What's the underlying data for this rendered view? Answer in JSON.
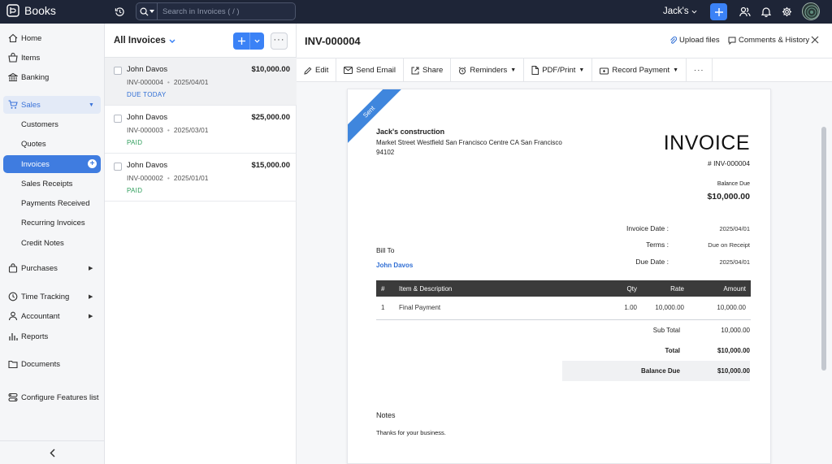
{
  "app": {
    "name": "Books"
  },
  "search": {
    "placeholder": "Search in Invoices ( / )"
  },
  "org": {
    "name": "Jack's"
  },
  "sidebar": {
    "items": [
      {
        "label": "Home",
        "icon": "home-icon"
      },
      {
        "label": "Items",
        "icon": "basket-icon"
      },
      {
        "label": "Banking",
        "icon": "bank-icon"
      },
      {
        "label": "Sales",
        "icon": "cart-icon"
      },
      {
        "label": "Customers"
      },
      {
        "label": "Quotes"
      },
      {
        "label": "Invoices"
      },
      {
        "label": "Sales Receipts"
      },
      {
        "label": "Payments Received"
      },
      {
        "label": "Recurring Invoices"
      },
      {
        "label": "Credit Notes"
      },
      {
        "label": "Purchases",
        "icon": "bag-icon"
      },
      {
        "label": "Time Tracking",
        "icon": "clock-icon"
      },
      {
        "label": "Accountant",
        "icon": "person-icon"
      },
      {
        "label": "Reports",
        "icon": "bar-chart-icon"
      },
      {
        "label": "Documents",
        "icon": "folder-icon"
      },
      {
        "label": "Configure Features list",
        "icon": "sliders-icon"
      }
    ],
    "collapse": "‹"
  },
  "list": {
    "title": "All Invoices",
    "more": "···",
    "rows": [
      {
        "customer": "John Davos",
        "amount": "$10,000.00",
        "number": "INV-000004",
        "date": "2025/04/01",
        "status": "DUE TODAY",
        "status_color": "#2f6ed4"
      },
      {
        "customer": "John Davos",
        "amount": "$25,000.00",
        "number": "INV-000003",
        "date": "2025/03/01",
        "status": "PAID",
        "status_color": "#2e9e5b"
      },
      {
        "customer": "John Davos",
        "amount": "$15,000.00",
        "number": "INV-000002",
        "date": "2025/01/01",
        "status": "PAID",
        "status_color": "#2e9e5b"
      }
    ]
  },
  "detail": {
    "title": "INV-000004",
    "upload": "Upload files",
    "comments": "Comments & History",
    "toolbar": {
      "edit": "Edit",
      "send_email": "Send Email",
      "share": "Share",
      "reminders": "Reminders",
      "pdf_print": "PDF/Print",
      "record_payment": "Record Payment",
      "more": "···"
    }
  },
  "invoice": {
    "ribbon": "Sent",
    "company": "Jack's construction",
    "address": "Market Street Westfield San Francisco Centre CA San Francisco 94102",
    "heading": "INVOICE",
    "number": "# INV-000004",
    "balance_label": "Balance Due",
    "balance_value": "$10,000.00",
    "invoice_date_label": "Invoice Date :",
    "invoice_date": "2025/04/01",
    "terms_label": "Terms :",
    "terms": "Due on Receipt",
    "due_date_label": "Due Date :",
    "due_date": "2025/04/01",
    "bill_to_label": "Bill To",
    "bill_to": "John Davos",
    "table": {
      "headers": [
        "#",
        "Item & Description",
        "Qty",
        "Rate",
        "Amount"
      ],
      "rows": [
        [
          "1",
          "Final Payment",
          "1.00",
          "10,000.00",
          "10,000.00"
        ]
      ]
    },
    "subtotal_label": "Sub Total",
    "subtotal": "10,000.00",
    "total_label": "Total",
    "total": "$10,000.00",
    "balance_due_label": "Balance Due",
    "balance_due": "$10,000.00",
    "notes_label": "Notes",
    "notes": "Thanks for your business."
  },
  "colors": {
    "topbar": "#1e2537",
    "accent": "#3b82f6",
    "ribbon": "#3f86dd"
  }
}
